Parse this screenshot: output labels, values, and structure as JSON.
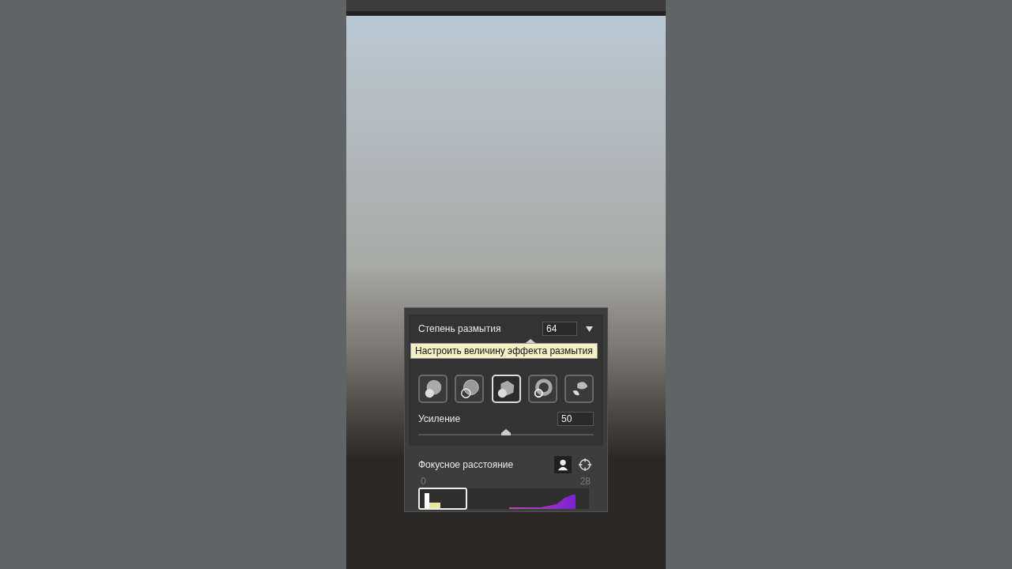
{
  "panel": {
    "blur": {
      "label": "Степень размытия",
      "value": "64",
      "level": 0.64
    },
    "tooltip": "Настроить величину эффекта размытия",
    "bokeh_shapes": [
      {
        "selected": false
      },
      {
        "selected": false
      },
      {
        "selected": true
      },
      {
        "selected": false
      },
      {
        "selected": false
      }
    ],
    "strength": {
      "label": "Усиление",
      "value": "50",
      "level": 0.5
    },
    "focus": {
      "label": "Фокусное расстояние",
      "modes": [
        {
          "kind": "person",
          "selected": true
        },
        {
          "kind": "crosshair",
          "selected": false
        }
      ],
      "range_min": "0",
      "range_max": "28"
    }
  }
}
